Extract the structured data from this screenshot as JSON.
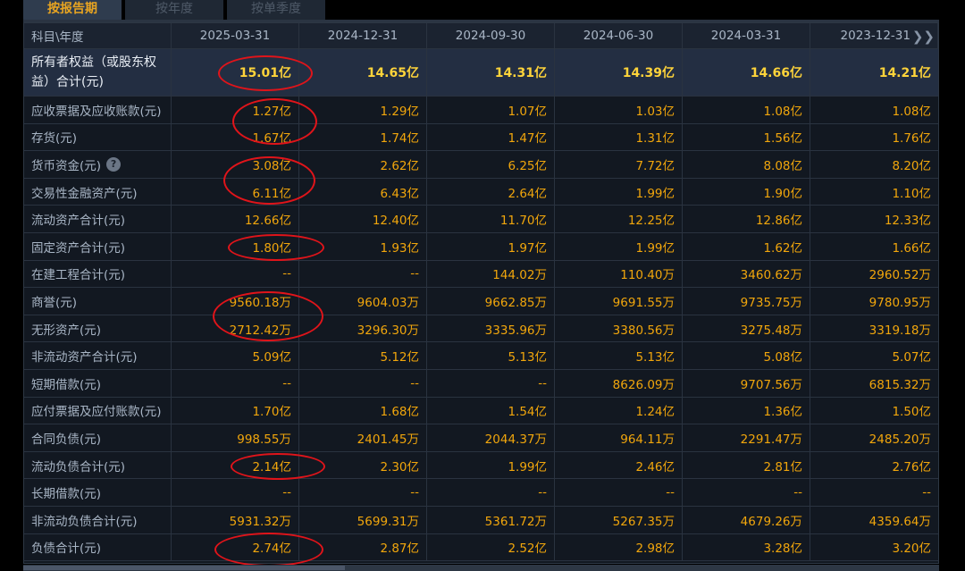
{
  "tabs": [
    {
      "label": "按报告期",
      "active": true
    },
    {
      "label": "按年度",
      "active": false
    },
    {
      "label": "按单季度",
      "active": false
    }
  ],
  "header": {
    "label": "科目\\年度",
    "dates": [
      "2025-03-31",
      "2024-12-31",
      "2024-09-30",
      "2024-06-30",
      "2024-03-31",
      "2023-12-31"
    ],
    "more_icon": "double-chevron-right-icon"
  },
  "equity": {
    "label_line1": "所有者权益（或股东权",
    "label_line2": "益）合计(元)",
    "values": [
      "15.01亿",
      "14.65亿",
      "14.31亿",
      "14.39亿",
      "14.66亿",
      "14.21亿"
    ]
  },
  "rows": [
    {
      "label": "应收票据及应收账款(元)",
      "values": [
        "1.27亿",
        "1.29亿",
        "1.07亿",
        "1.03亿",
        "1.08亿",
        "1.08亿"
      ]
    },
    {
      "label": "存货(元)",
      "values": [
        "1.67亿",
        "1.74亿",
        "1.47亿",
        "1.31亿",
        "1.56亿",
        "1.76亿"
      ]
    },
    {
      "label": "货币资金(元)",
      "values": [
        "3.08亿",
        "2.62亿",
        "6.25亿",
        "7.72亿",
        "8.08亿",
        "8.20亿"
      ],
      "info_icon": "?"
    },
    {
      "label": "交易性金融资产(元)",
      "values": [
        "6.11亿",
        "6.43亿",
        "2.64亿",
        "1.99亿",
        "1.90亿",
        "1.10亿"
      ]
    },
    {
      "label": "流动资产合计(元)",
      "values": [
        "12.66亿",
        "12.40亿",
        "11.70亿",
        "12.25亿",
        "12.86亿",
        "12.33亿"
      ]
    },
    {
      "label": "固定资产合计(元)",
      "values": [
        "1.80亿",
        "1.93亿",
        "1.97亿",
        "1.99亿",
        "1.62亿",
        "1.66亿"
      ]
    },
    {
      "label": "在建工程合计(元)",
      "values": [
        "--",
        "--",
        "144.02万",
        "110.40万",
        "3460.62万",
        "2960.52万"
      ]
    },
    {
      "label": "商誉(元)",
      "values": [
        "9560.18万",
        "9604.03万",
        "9662.85万",
        "9691.55万",
        "9735.75万",
        "9780.95万"
      ]
    },
    {
      "label": "无形资产(元)",
      "values": [
        "2712.42万",
        "3296.30万",
        "3335.96万",
        "3380.56万",
        "3275.48万",
        "3319.18万"
      ]
    },
    {
      "label": "非流动资产合计(元)",
      "values": [
        "5.09亿",
        "5.12亿",
        "5.13亿",
        "5.13亿",
        "5.08亿",
        "5.07亿"
      ]
    },
    {
      "label": "短期借款(元)",
      "values": [
        "--",
        "--",
        "--",
        "8626.09万",
        "9707.56万",
        "6815.32万"
      ]
    },
    {
      "label": "应付票据及应付账款(元)",
      "values": [
        "1.70亿",
        "1.68亿",
        "1.54亿",
        "1.24亿",
        "1.36亿",
        "1.50亿"
      ]
    },
    {
      "label": "合同负债(元)",
      "values": [
        "998.55万",
        "2401.45万",
        "2044.37万",
        "964.11万",
        "2291.47万",
        "2485.20万"
      ]
    },
    {
      "label": "流动负债合计(元)",
      "values": [
        "2.14亿",
        "2.30亿",
        "1.99亿",
        "2.46亿",
        "2.81亿",
        "2.76亿"
      ]
    },
    {
      "label": "长期借款(元)",
      "values": [
        "--",
        "--",
        "--",
        "--",
        "--",
        "--"
      ]
    },
    {
      "label": "非流动负债合计(元)",
      "values": [
        "5931.32万",
        "5699.31万",
        "5361.72万",
        "5267.35万",
        "4679.26万",
        "4359.64万"
      ]
    },
    {
      "label": "负债合计(元)",
      "values": [
        "2.74亿",
        "2.87亿",
        "2.52亿",
        "2.98亿",
        "3.28亿",
        "3.20亿"
      ]
    }
  ],
  "colors": {
    "accent": "#f1a60c",
    "highlight": "#ffd43a",
    "annotation": "#e0141a",
    "background": "#121821"
  }
}
